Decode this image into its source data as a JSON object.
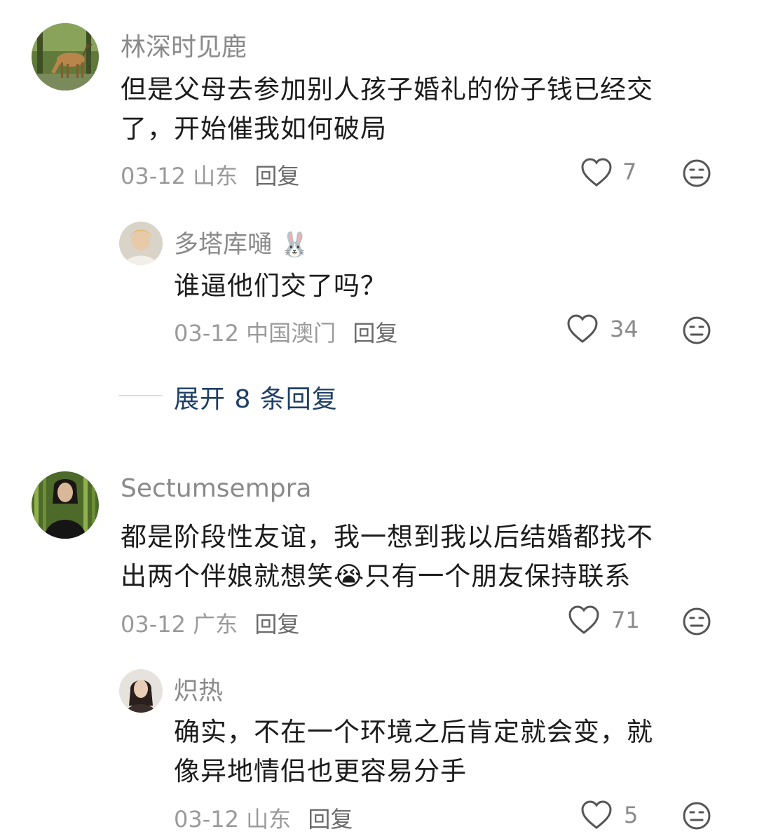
{
  "comments": [
    {
      "user": "林深时见鹿",
      "text_lines": [
        "但是父母去参加别人孩子婚礼的份子钱已经交",
        "了，开始催我如何破局"
      ],
      "date": "03-12",
      "location": "山东",
      "reply_label": "回复",
      "likes": "7",
      "avatar_icon": "deer-avatar",
      "replies": [
        {
          "user": "多塔库嗵",
          "user_emoji": "🐰",
          "text_lines": [
            "谁逼他们交了吗？"
          ],
          "date": "03-12",
          "location": "中国澳门",
          "reply_label": "回复",
          "likes": "34",
          "avatar_icon": "person-avatar"
        }
      ],
      "expand_label": "展开 8 条回复"
    },
    {
      "user": "Sectumsempra",
      "text_lines": [
        "都是阶段性友谊，我一想到我以后结婚都找不",
        "出两个伴娘就想笑",
        "只有一个朋友保持联系"
      ],
      "inline_emoji": "😭",
      "date": "03-12",
      "location": "广东",
      "reply_label": "回复",
      "likes": "71",
      "avatar_icon": "snape-avatar",
      "replies": [
        {
          "user": "炽热",
          "text_lines": [
            "确实，不在一个环境之后肯定就会变，就",
            "像异地情侣也更容易分手"
          ],
          "date": "03-12",
          "location": "山东",
          "reply_label": "回复",
          "likes": "5",
          "avatar_icon": "woman-avatar"
        }
      ]
    }
  ],
  "icons": {
    "like": "heart-outline-icon",
    "more": "neutral-face-icon"
  },
  "colors": {
    "username": "#8a8a8a",
    "text": "#1c1c1c",
    "meta": "#9a9a9a",
    "expand": "#1f3f66",
    "divider": "#dcdcdc"
  }
}
